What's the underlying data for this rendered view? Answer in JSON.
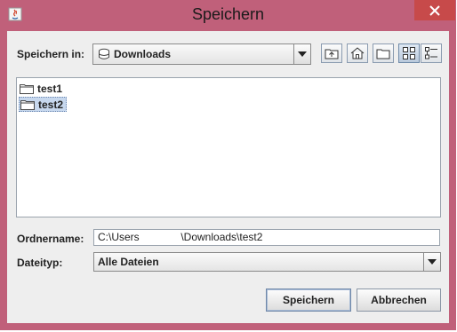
{
  "window": {
    "title": "Speichern"
  },
  "toolbar": {
    "save_in_label": "Speichern in:",
    "location": "Downloads",
    "buttons": {
      "up": "up-one-level-icon",
      "home": "home-icon",
      "new_folder": "new-folder-icon",
      "list_view": "list-view-icon",
      "details_view": "details-view-icon"
    }
  },
  "files": [
    {
      "name": "test1",
      "selected": false
    },
    {
      "name": "test2",
      "selected": true
    }
  ],
  "folder_name": {
    "label": "Ordnername:",
    "value": "C:\\Users              \\Downloads\\test2"
  },
  "file_type": {
    "label": "Dateityp:",
    "value": "Alle Dateien"
  },
  "actions": {
    "save_label": "Speichern",
    "cancel_label": "Abbrechen"
  },
  "colors": {
    "frame": "#c0607a",
    "close": "#c74a4a",
    "selection": "#c7d8ee"
  }
}
